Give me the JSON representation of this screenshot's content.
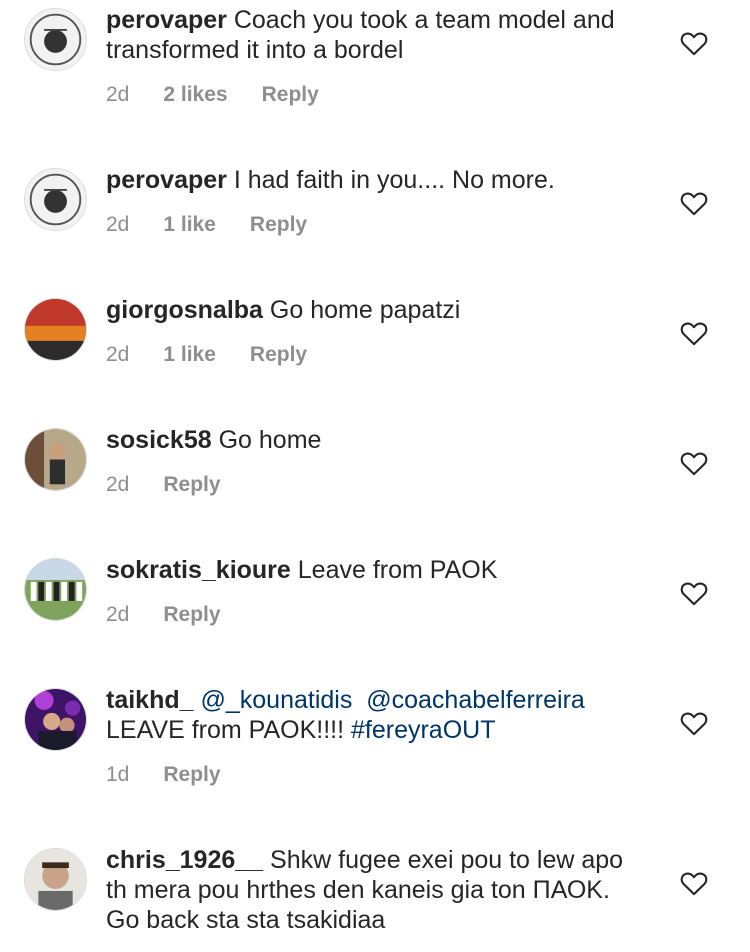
{
  "comments": [
    {
      "username": "perovaper",
      "text": "Coach you took a team model and transformed it into a bordel",
      "time": "2d",
      "likes": "2 likes",
      "reply": "Reply",
      "avatar_icon": "crest-avatar"
    },
    {
      "username": "perovaper",
      "text": "I had faith in you.... No more.",
      "time": "2d",
      "likes": "1 like",
      "reply": "Reply",
      "avatar_icon": "crest-avatar"
    },
    {
      "username": "giorgosnalba",
      "text": "Go home papatzi",
      "time": "2d",
      "likes": "1 like",
      "reply": "Reply",
      "avatar_icon": "stadium-photo-avatar"
    },
    {
      "username": "sosick58",
      "text": "Go home",
      "time": "2d",
      "reply": "Reply",
      "avatar_icon": "person-photo-avatar"
    },
    {
      "username": "sokratis_kioure",
      "text": "Leave from PAOK",
      "time": "2d",
      "reply": "Reply",
      "avatar_icon": "team-photo-avatar"
    },
    {
      "username": "taikhd_",
      "mention1": "@_kounatidis",
      "mention2": "@coachabelferreira",
      "text": "LEAVE from PAOK!!!!",
      "hashtag": "#fereyraOUT",
      "time": "1d",
      "reply": "Reply",
      "avatar_icon": "purple-photo-avatar"
    },
    {
      "username": "chris_1926__",
      "text": "Shkw fugee exei pou to lew apo th mera pou hrthes den kaneis gia ton ΠΑΟΚ. Go back sta sta tsakidiaa",
      "avatar_icon": "portrait-avatar"
    }
  ],
  "colors": {
    "text": "#262626",
    "meta": "#8e8e8e",
    "link": "#003569",
    "background": "#ffffff"
  }
}
